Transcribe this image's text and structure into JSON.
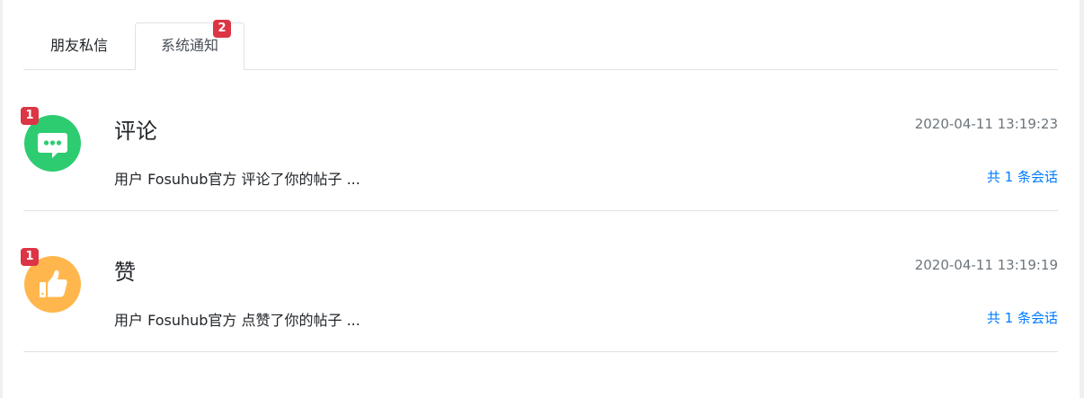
{
  "tabs": {
    "friends_label": "朋友私信",
    "system_label": "系统通知",
    "system_badge": "2"
  },
  "colors": {
    "badge": "#dc3545",
    "link": "#007bff",
    "comment_avatar": "#2ecc71",
    "like_avatar": "#ffb74d"
  },
  "notifications": [
    {
      "icon": "comment-bubble-icon",
      "badge": "1",
      "title": "评论",
      "time": "2020-04-11 13:19:23",
      "description": "用户 Fosuhub官方 评论了你的帖子 ...",
      "count_label": "共 1 条会话"
    },
    {
      "icon": "thumbs-up-icon",
      "badge": "1",
      "title": "赞",
      "time": "2020-04-11 13:19:19",
      "description": "用户 Fosuhub官方 点赞了你的帖子 ...",
      "count_label": "共 1 条会话"
    }
  ]
}
